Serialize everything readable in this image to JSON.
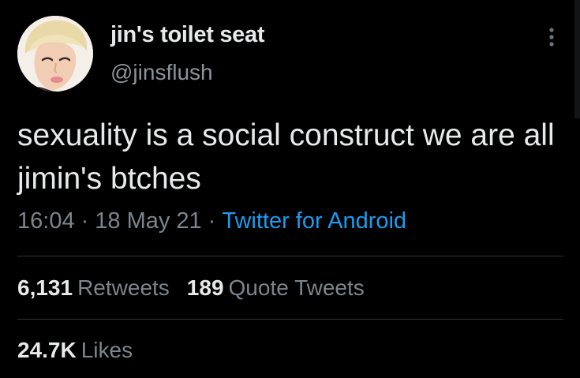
{
  "author": {
    "display_name": "jin's toilet seat",
    "handle": "@jinsflush",
    "avatar_icon": "profile-photo"
  },
  "tweet": {
    "text": "sexuality is a social construct we are all jimin's btches",
    "time": "16:04",
    "date": "18 May 21",
    "separator": "·",
    "source": "Twitter for Android"
  },
  "stats": {
    "retweets_count": "6,131",
    "retweets_label": "Retweets",
    "quotes_count": "189",
    "quotes_label": "Quote Tweets",
    "likes_count": "24.7K",
    "likes_label": "Likes"
  },
  "icons": {
    "more": "more-vertical-icon"
  },
  "colors": {
    "background": "#000000",
    "text_primary": "#e7e9ea",
    "text_secondary": "#7c858c",
    "link": "#1d9bf0",
    "divider": "#2f3336"
  }
}
